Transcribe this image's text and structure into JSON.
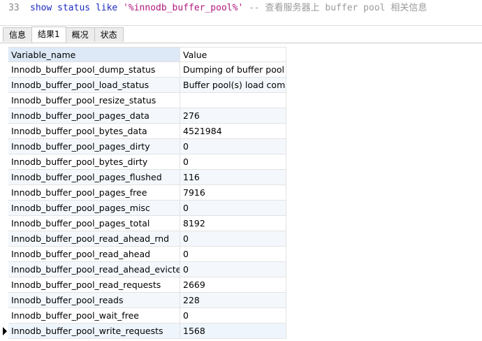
{
  "editor": {
    "line_number": "33",
    "kw_show": "show",
    "kw_status": "status",
    "kw_like": "like",
    "pattern": "'%innodb_buffer_pool%'",
    "comment": "-- 查看服务器上 buffer pool 相关信息"
  },
  "tabs": [
    {
      "label": "信息",
      "active": false
    },
    {
      "label": "结果1",
      "active": true
    },
    {
      "label": "概况",
      "active": false
    },
    {
      "label": "状态",
      "active": false
    }
  ],
  "grid": {
    "columns": [
      "Variable_name",
      "Value"
    ],
    "rows": [
      [
        "Innodb_buffer_pool_dump_status",
        "Dumping of buffer pool not started"
      ],
      [
        "Innodb_buffer_pool_load_status",
        "Buffer pool(s) load completed"
      ],
      [
        "Innodb_buffer_pool_resize_status",
        ""
      ],
      [
        "Innodb_buffer_pool_pages_data",
        "276"
      ],
      [
        "Innodb_buffer_pool_bytes_data",
        "4521984"
      ],
      [
        "Innodb_buffer_pool_pages_dirty",
        "0"
      ],
      [
        "Innodb_buffer_pool_bytes_dirty",
        "0"
      ],
      [
        "Innodb_buffer_pool_pages_flushed",
        "116"
      ],
      [
        "Innodb_buffer_pool_pages_free",
        "7916"
      ],
      [
        "Innodb_buffer_pool_pages_misc",
        "0"
      ],
      [
        "Innodb_buffer_pool_pages_total",
        "8192"
      ],
      [
        "Innodb_buffer_pool_read_ahead_rnd",
        "0"
      ],
      [
        "Innodb_buffer_pool_read_ahead",
        "0"
      ],
      [
        "Innodb_buffer_pool_read_ahead_evicted",
        "0"
      ],
      [
        "Innodb_buffer_pool_read_requests",
        "2669"
      ],
      [
        "Innodb_buffer_pool_reads",
        "228"
      ],
      [
        "Innodb_buffer_pool_wait_free",
        "0"
      ],
      [
        "Innodb_buffer_pool_write_requests",
        "1568"
      ]
    ],
    "current_row_index": 17
  }
}
